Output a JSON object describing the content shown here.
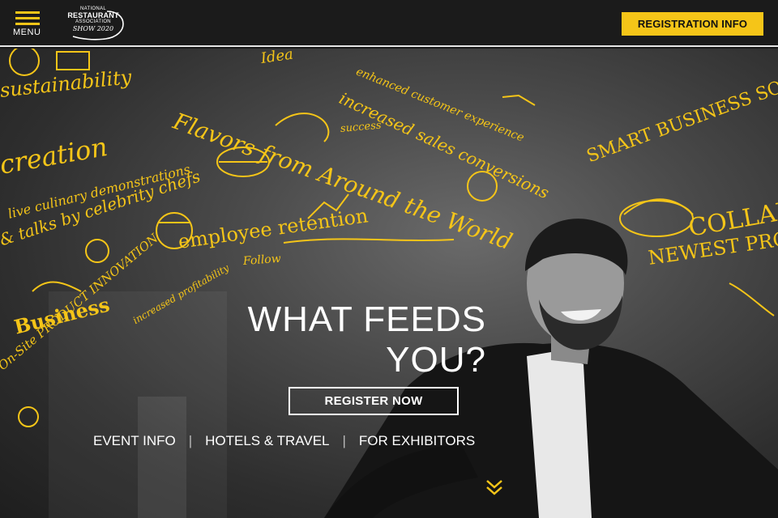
{
  "header": {
    "menu_label": "MENU",
    "logo": {
      "line1": "NATIONAL",
      "line2": "RESTAURANT",
      "line3": "ASSOCIATION",
      "line4": "SHOW 2020"
    },
    "registration_info_label": "REGISTRATION INFO"
  },
  "hero": {
    "headline_line1": "WHAT FEEDS",
    "headline_line2": "YOU?",
    "register_now_label": "REGISTER NOW",
    "nav": [
      {
        "label": "EVENT INFO"
      },
      {
        "label": "HOTELS & TRAVEL"
      },
      {
        "label": "FOR EXHIBITORS"
      }
    ],
    "separator": "|",
    "doodles": [
      "sustainability",
      "creation",
      "Flavors from Around the World",
      "enhanced customer experience",
      "increased sales conversions",
      "success",
      "Idea",
      "live culinary demonstrations",
      "& talks by celebrity chefs",
      "employee retention",
      "Follow",
      "Business",
      "On-Site PRODUCT INNOVATION",
      "increased profitability",
      "SMART BUSINESS SOLUTIO",
      "COLLAB",
      "NEWEST PRODU"
    ]
  },
  "colors": {
    "accent": "#f5c518",
    "header_bg": "#1b1b1b",
    "text": "#ffffff"
  }
}
